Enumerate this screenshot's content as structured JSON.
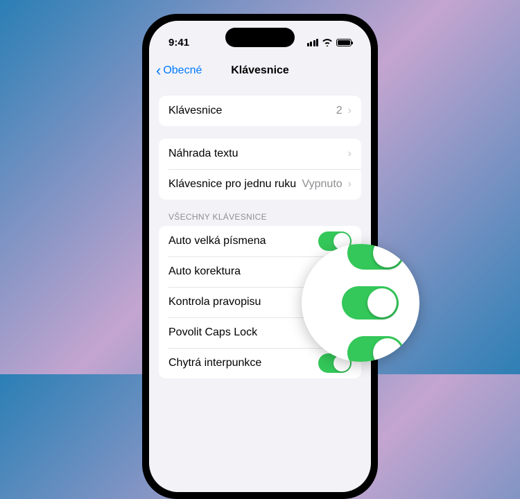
{
  "status": {
    "time": "9:41"
  },
  "nav": {
    "back": "Obecné",
    "title": "Klávesnice"
  },
  "rows": {
    "keyboards": {
      "label": "Klávesnice",
      "value": "2"
    },
    "textReplace": {
      "label": "Náhrada textu"
    },
    "oneHand": {
      "label": "Klávesnice pro jednu ruku",
      "value": "Vypnuto"
    }
  },
  "sectionHeader": "VŠECHNY KLÁVESNICE",
  "toggles": {
    "autoCaps": {
      "label": "Auto velká písmena",
      "on": true
    },
    "autoCorrect": {
      "label": "Auto korektura",
      "on": true
    },
    "spellCheck": {
      "label": "Kontrola pravopisu",
      "on": true
    },
    "capsLock": {
      "label": "Povolit Caps Lock",
      "on": true
    },
    "smartPunct": {
      "label": "Chytrá interpunkce",
      "on": true
    }
  },
  "colors": {
    "accent": "#007aff",
    "toggleOn": "#34c759"
  }
}
